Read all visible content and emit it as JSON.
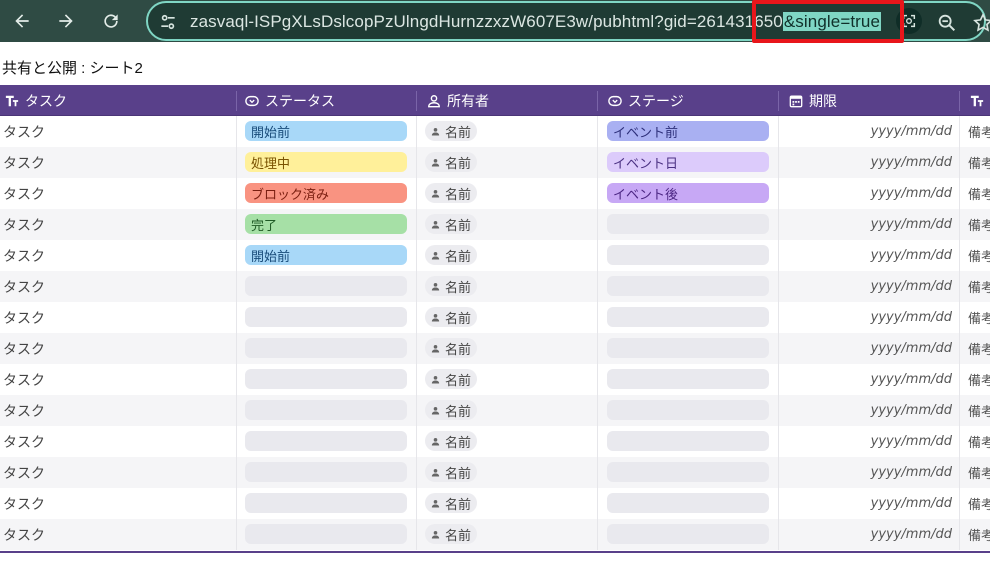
{
  "browser": {
    "url_main": "zasvaql-ISPgXLsDslcopPzUlngdHurnzzxzW607E3w/pubhtml?gid=261431650",
    "url_selected": "&single=true"
  },
  "page": {
    "sheet_title": "共有と公開 : シート2"
  },
  "columns": [
    "タスク",
    "ステータス",
    "所有者",
    "ステージ",
    "期限",
    ""
  ],
  "rows": [
    {
      "task": "タスク",
      "status": "開始前",
      "owner": "名前",
      "stage": "イベント前",
      "date": "yyyy/mm/dd",
      "memo": "備考"
    },
    {
      "task": "タスク",
      "status": "処理中",
      "owner": "名前",
      "stage": "イベント日",
      "date": "yyyy/mm/dd",
      "memo": "備考"
    },
    {
      "task": "タスク",
      "status": "ブロック済み",
      "owner": "名前",
      "stage": "イベント後",
      "date": "yyyy/mm/dd",
      "memo": "備考"
    },
    {
      "task": "タスク",
      "status": "完了",
      "owner": "名前",
      "stage": "",
      "date": "yyyy/mm/dd",
      "memo": "備考"
    },
    {
      "task": "タスク",
      "status": "開始前",
      "owner": "名前",
      "stage": "",
      "date": "yyyy/mm/dd",
      "memo": "備考"
    },
    {
      "task": "タスク",
      "status": "",
      "owner": "名前",
      "stage": "",
      "date": "yyyy/mm/dd",
      "memo": "備考"
    },
    {
      "task": "タスク",
      "status": "",
      "owner": "名前",
      "stage": "",
      "date": "yyyy/mm/dd",
      "memo": "備考"
    },
    {
      "task": "タスク",
      "status": "",
      "owner": "名前",
      "stage": "",
      "date": "yyyy/mm/dd",
      "memo": "備考"
    },
    {
      "task": "タスク",
      "status": "",
      "owner": "名前",
      "stage": "",
      "date": "yyyy/mm/dd",
      "memo": "備考"
    },
    {
      "task": "タスク",
      "status": "",
      "owner": "名前",
      "stage": "",
      "date": "yyyy/mm/dd",
      "memo": "備考"
    },
    {
      "task": "タスク",
      "status": "",
      "owner": "名前",
      "stage": "",
      "date": "yyyy/mm/dd",
      "memo": "備考"
    },
    {
      "task": "タスク",
      "status": "",
      "owner": "名前",
      "stage": "",
      "date": "yyyy/mm/dd",
      "memo": "備考"
    },
    {
      "task": "タスク",
      "status": "",
      "owner": "名前",
      "stage": "",
      "date": "yyyy/mm/dd",
      "memo": "備考"
    },
    {
      "task": "タスク",
      "status": "",
      "owner": "名前",
      "stage": "",
      "date": "yyyy/mm/dd",
      "memo": "備考"
    }
  ],
  "chip_colors": {
    "開始前": {
      "bg": "#a8d8f8",
      "fg": "#174a78"
    },
    "処理中": {
      "bg": "#fff09a",
      "fg": "#7a5200"
    },
    "ブロック済み": {
      "bg": "#f99381",
      "fg": "#7a1e10"
    },
    "完了": {
      "bg": "#a6e0a6",
      "fg": "#1f5a25"
    },
    "イベント前": {
      "bg": "#a9b0f2",
      "fg": "#2d2f7a"
    },
    "イベント日": {
      "bg": "#dccbfb",
      "fg": "#4b3183"
    },
    "イベント後": {
      "bg": "#c7a8f5",
      "fg": "#4b2583"
    },
    "": {
      "bg": "#e9e9ee",
      "fg": "#444444"
    }
  },
  "icons": [
    "back-icon",
    "forward-icon",
    "reload-icon",
    "site-settings-icon",
    "lens-icon",
    "zoom-icon",
    "bookmark-star-icon"
  ]
}
